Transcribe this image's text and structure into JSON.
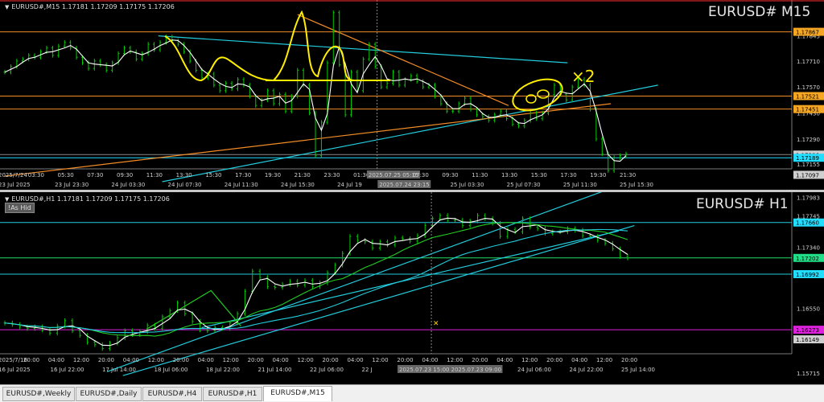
{
  "tabs": [
    {
      "label": "EURUSD#,Weekly",
      "active": false
    },
    {
      "label": "EURUSD#,Daily",
      "active": false
    },
    {
      "label": "EURUSD#,H4",
      "active": false
    },
    {
      "label": "EURUSD#,H1",
      "active": false
    },
    {
      "label": "EURUSD#,M15",
      "active": true
    }
  ],
  "as_hidden_label": "!As Hid",
  "annotation_x2": "×2",
  "chart_data": [
    {
      "type": "line",
      "header": "EURUSD#,M15  1.17181 1.17209 1.17175 1.17206",
      "title": "EURUSD# M15",
      "ylim": [
        1.1706,
        1.17995
      ],
      "grid": false,
      "y_tick_labels": [
        {
          "value": 1.17845,
          "label": "1.17845"
        },
        {
          "value": 1.1771,
          "label": "1.17710"
        },
        {
          "value": 1.1757,
          "label": "1.17570"
        },
        {
          "value": 1.1743,
          "label": "1.17430"
        },
        {
          "value": 1.1729,
          "label": "1.17290"
        },
        {
          "value": 1.17155,
          "label": "1.17155"
        }
      ],
      "price_tags": [
        {
          "value": 1.17867,
          "label": "1.17867",
          "color": "#f5a623"
        },
        {
          "value": 1.17521,
          "label": "1.17521",
          "color": "#f5a623"
        },
        {
          "value": 1.17451,
          "label": "1.17451",
          "color": "#f5a623"
        },
        {
          "value": 1.17206,
          "label": "1.17206",
          "color": "#cfcfcf"
        },
        {
          "value": 1.17189,
          "label": "1.17189",
          "color": "#22ddff"
        },
        {
          "value": 1.17097,
          "label": "1.17097",
          "color": "#cfcfcf"
        }
      ],
      "hlines": [
        {
          "value": 1.17867,
          "color": "#f28c28"
        },
        {
          "value": 1.17521,
          "color": "#f28c28"
        },
        {
          "value": 1.17451,
          "color": "#f28c28"
        },
        {
          "value": 1.17206,
          "color": "#888888"
        },
        {
          "value": 1.17189,
          "color": "#22ddff"
        }
      ],
      "x_tick_labels": [
        "2025/7/24",
        "03:30",
        "05:30",
        "07:30",
        "09:30",
        "11:30",
        "13:30",
        "15:30",
        "17:30",
        "19:30",
        "21:30",
        "23:30",
        "01:30",
        "2025.07.25 05:15",
        "07:30",
        "09:30",
        "11:30",
        "13:30",
        "15:30",
        "17:30",
        "19:30",
        "21:30"
      ],
      "date_labels": [
        "23 Jul 2025",
        "23 Jul 23:30",
        "24 Jul 03:30",
        "24 Jul 07:30",
        "24 Jul 11:30",
        "24 Jul 15:30",
        "24 Jul 19",
        "2025.07.24 23:15",
        "25 Jul 03:30",
        "25 Jul 07:30",
        "25 Jul 11:30",
        "25 Jul 15:30"
      ],
      "close": [
        1.1765,
        1.1768,
        1.1771,
        1.1772,
        1.1774,
        1.1773,
        1.1776,
        1.1778,
        1.1774,
        1.1779,
        1.1781,
        1.1778,
        1.1773,
        1.177,
        1.1767,
        1.1771,
        1.1769,
        1.1766,
        1.177,
        1.1775,
        1.1778,
        1.1776,
        1.1772,
        1.1775,
        1.178,
        1.1777,
        1.1781,
        1.1784,
        1.1782,
        1.178,
        1.1776,
        1.1771,
        1.1766,
        1.1762,
        1.1764,
        1.1758,
        1.1755,
        1.1759,
        1.1756,
        1.1761,
        1.1758,
        1.1752,
        1.1747,
        1.175,
        1.1755,
        1.1748,
        1.1753,
        1.1744,
        1.1752,
        1.1766,
        1.1758,
        1.1743,
        1.172,
        1.1738,
        1.177,
        1.1797,
        1.1769,
        1.1742,
        1.1765,
        1.1755,
        1.1772,
        1.178,
        1.1768,
        1.1757,
        1.1759,
        1.1765,
        1.1758,
        1.1761,
        1.1763,
        1.176,
        1.1757,
        1.1758,
        1.1752,
        1.1748,
        1.1744,
        1.1744,
        1.1748,
        1.1751,
        1.1745,
        1.1742,
        1.1741,
        1.1739,
        1.1742,
        1.1744,
        1.174,
        1.1737,
        1.1736,
        1.1739,
        1.1743,
        1.174,
        1.1743,
        1.1753,
        1.1758,
        1.1753,
        1.175,
        1.1757,
        1.1761,
        1.1758,
        1.1745,
        1.1729,
        1.1721,
        1.1712,
        1.1719,
        1.172,
        1.1721
      ],
      "ma_color": "#ffffff",
      "drawings": [
        {
          "kind": "trendline",
          "color": "#22ccdd",
          "from": [
            0.195,
            1.17845
          ],
          "to": [
            0.715,
            1.177
          ]
        },
        {
          "kind": "trendline",
          "color": "#22ccdd",
          "from": [
            0.2,
            1.1706
          ],
          "to": [
            0.83,
            1.1758
          ]
        },
        {
          "kind": "trendline",
          "color": "#f28c28",
          "from": [
            0.0,
            1.1709
          ],
          "to": [
            0.77,
            1.1748
          ]
        },
        {
          "kind": "trendline",
          "color": "#f28c28",
          "from": [
            0.372,
            1.1796
          ],
          "to": [
            0.64,
            1.1747
          ]
        },
        {
          "kind": "vline",
          "color": "#888888",
          "at": 0.473
        }
      ]
    },
    {
      "type": "line",
      "header": "EURUSD#,H1  1.17181 1.17209 1.17175 1.17206",
      "title": "EURUSD# H1",
      "ylim": [
        1.1564,
        1.1799
      ],
      "grid": false,
      "y_tick_labels": [
        {
          "value": 1.17983,
          "label": "1.17983"
        },
        {
          "value": 1.17745,
          "label": "1.17745"
        },
        {
          "value": 1.1734,
          "label": "1.17340"
        },
        {
          "value": 1.1699,
          "label": "1.16990"
        },
        {
          "value": 1.1655,
          "label": "1.16550"
        },
        {
          "value": 1.15715,
          "label": "1.15715"
        }
      ],
      "price_tags": [
        {
          "value": 1.1766,
          "label": "1.17660",
          "color": "#22ddff"
        },
        {
          "value": 1.17202,
          "label": "1.17202",
          "color": "#22dd88"
        },
        {
          "value": 1.16992,
          "label": "1.16992",
          "color": "#22ddff"
        },
        {
          "value": 1.16273,
          "label": "1.16273",
          "color": "#dd22dd"
        },
        {
          "value": 1.16149,
          "label": "1.16149",
          "color": "#cfcfcf"
        }
      ],
      "hlines": [
        {
          "value": 1.1766,
          "color": "#22ccdd"
        },
        {
          "value": 1.17202,
          "color": "#22dd66"
        },
        {
          "value": 1.16992,
          "color": "#22ccdd"
        },
        {
          "value": 1.16273,
          "color": "#dd22dd"
        }
      ],
      "x_tick_labels": [
        "2025/7/16",
        "20:00",
        "04:00",
        "12:00",
        "20:00",
        "04:00",
        "12:00",
        "20:00",
        "04:00",
        "12:00",
        "20:00",
        "04:00",
        "12:00",
        "20:00",
        "04:00",
        "12:00",
        "20:00",
        "04:00",
        "12:00",
        "20:00",
        "04:00",
        "12:00",
        "20:00",
        "04:00",
        "12:00",
        "20:00"
      ],
      "date_labels": [
        "16 Jul 2025",
        "16 Jul 22:00",
        "17 Jul 14:00",
        "18 Jul 06:00",
        "18 Jul 22:00",
        "21 Jul 14:00",
        "22 Jul 06:00",
        "22 J",
        "2025.07.23 15:00",
        "2025.07.23 09:00",
        "24 Jul 06:00",
        "24 Jul 22:00",
        "25 Jul 14:00"
      ],
      "close": [
        1.1636,
        1.1634,
        1.1631,
        1.1629,
        1.1631,
        1.1627,
        1.1623,
        1.1632,
        1.1639,
        1.1626,
        1.162,
        1.1611,
        1.1608,
        1.1603,
        1.161,
        1.1617,
        1.1626,
        1.1621,
        1.1625,
        1.1633,
        1.1629,
        1.1644,
        1.1652,
        1.1662,
        1.1648,
        1.1638,
        1.1627,
        1.1626,
        1.163,
        1.1629,
        1.1636,
        1.1648,
        1.1677,
        1.1703,
        1.1695,
        1.1683,
        1.1682,
        1.1686,
        1.169,
        1.1685,
        1.1691,
        1.1683,
        1.1688,
        1.1701,
        1.1711,
        1.1726,
        1.1748,
        1.1743,
        1.1741,
        1.1733,
        1.1741,
        1.1737,
        1.1746,
        1.1745,
        1.1742,
        1.1749,
        1.1762,
        1.1771,
        1.1775,
        1.1769,
        1.1769,
        1.1762,
        1.1768,
        1.1775,
        1.1771,
        1.1765,
        1.1748,
        1.1757,
        1.1754,
        1.1771,
        1.176,
        1.1758,
        1.1752,
        1.1754,
        1.1754,
        1.1758,
        1.1756,
        1.1749,
        1.1748,
        1.1743,
        1.1739,
        1.1732,
        1.1722,
        1.172
      ],
      "ma_lines": [
        {
          "name": "",
          "color": "#ffffff",
          "period": 3
        },
        {
          "name": "",
          "color": "#22cc22",
          "period": 12
        },
        {
          "name": "",
          "color": "#22ccdd",
          "period": 30
        }
      ],
      "drawings": [
        {
          "kind": "trendline",
          "color": "#22ccdd",
          "from": [
            0.13,
            1.1573
          ],
          "to": [
            0.77,
            1.181
          ]
        },
        {
          "kind": "trendline",
          "color": "#22ccdd",
          "from": [
            0.15,
            1.1568
          ],
          "to": [
            0.8,
            1.1762
          ]
        },
        {
          "kind": "trendline",
          "color": "#22ccdd",
          "from": [
            0.25,
            1.163
          ],
          "to": [
            0.78,
            1.1755
          ]
        },
        {
          "kind": "polyline",
          "color": "#22cc22",
          "points": [
            [
              0.18,
              1.1628
            ],
            [
              0.262,
              1.1678
            ],
            [
              0.3,
              1.1632
            ]
          ]
        },
        {
          "kind": "vline",
          "color": "#888888",
          "at": 0.542
        }
      ]
    }
  ]
}
